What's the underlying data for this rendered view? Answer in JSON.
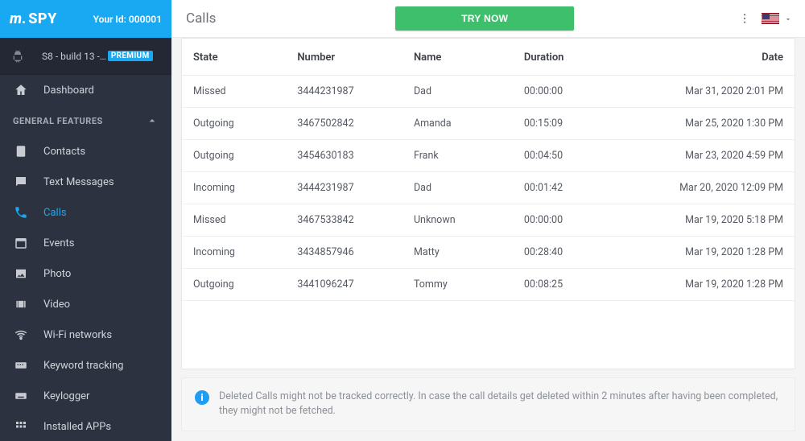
{
  "brand": {
    "logo_text": "SPY",
    "your_id_label": "Your Id: 000001"
  },
  "device": {
    "name_prefix": "S8 - build 13 -…",
    "badge": "PREMIUM"
  },
  "sidebar": {
    "dashboard": "Dashboard",
    "section_general": "GENERAL FEATURES",
    "items": [
      {
        "label": "Contacts"
      },
      {
        "label": "Text Messages"
      },
      {
        "label": "Calls"
      },
      {
        "label": "Events"
      },
      {
        "label": "Photo"
      },
      {
        "label": "Video"
      },
      {
        "label": "Wi-Fi networks"
      },
      {
        "label": "Keyword tracking"
      },
      {
        "label": "Keylogger"
      },
      {
        "label": "Installed APPs"
      }
    ]
  },
  "topbar": {
    "title": "Calls",
    "try_now": "TRY NOW"
  },
  "table": {
    "headers": {
      "state": "State",
      "number": "Number",
      "name": "Name",
      "duration": "Duration",
      "date": "Date"
    },
    "rows": [
      {
        "state": "Missed",
        "number": "3444231987",
        "name": "Dad",
        "duration": "00:00:00",
        "date": "Mar 31, 2020 2:01 PM"
      },
      {
        "state": "Outgoing",
        "number": "3467502842",
        "name": "Amanda",
        "duration": "00:15:09",
        "date": "Mar 25, 2020 1:30 PM"
      },
      {
        "state": "Outgoing",
        "number": "3454630183",
        "name": "Frank",
        "duration": "00:04:50",
        "date": "Mar 23, 2020 4:59 PM"
      },
      {
        "state": "Incoming",
        "number": "3444231987",
        "name": "Dad",
        "duration": "00:01:42",
        "date": "Mar 20, 2020 12:09 PM"
      },
      {
        "state": "Missed",
        "number": "3467533842",
        "name": "Unknown",
        "duration": "00:00:00",
        "date": "Mar 19, 2020 5:18 PM"
      },
      {
        "state": "Incoming",
        "number": "3434857946",
        "name": "Matty",
        "duration": "00:28:40",
        "date": "Mar 19, 2020 1:28 PM"
      },
      {
        "state": "Outgoing",
        "number": "3441096247",
        "name": "Tommy",
        "duration": "00:08:25",
        "date": "Mar 19, 2020 1:28 PM"
      }
    ]
  },
  "notice": {
    "text": "Deleted Calls might not be tracked correctly. In case the call details get deleted within 2 minutes after having been completed, they might not be fetched.",
    "icon_label": "i"
  }
}
